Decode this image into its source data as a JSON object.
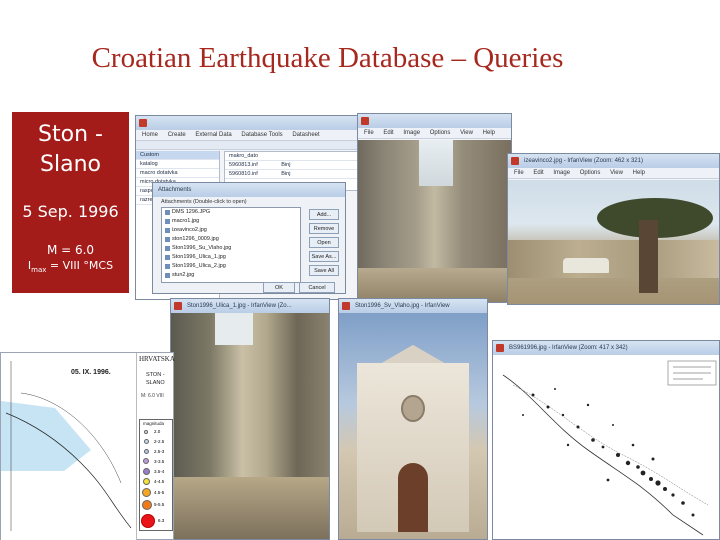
{
  "slide": {
    "title": "Croatian Earthquake Database – Queries"
  },
  "info": {
    "place": "Ston - Slano",
    "date": "5 Sep. 1996",
    "magnitude": "M = 6.0",
    "intensity_prefix": "I",
    "intensity_sub": "max",
    "intensity_rest": " =  VIII °MCS"
  },
  "access_window": {
    "menu": [
      "Home",
      "Create",
      "External Data",
      "Database Tools",
      "Datasheet"
    ],
    "nav_items": [
      "Custom",
      "katalog",
      "macro dotatvka",
      "micro dotatvka",
      "rasporedi",
      "razresj"
    ],
    "table_values": [
      "makro_dato",
      "5960813.inf",
      "5960810.inf"
    ],
    "table_right": [
      "Binj",
      "Binj"
    ]
  },
  "attachments_dialog": {
    "title": "Attachments",
    "label": "Attachments (Double-click to open)",
    "files": [
      "DMS 1296.JPG",
      "macro1.jpg",
      "izeavinco2.jpg",
      "ston1296_0009.jpg",
      "Ston1996_Su_Vlaho.jpg",
      "Ston1996_Ulica_1.jpg",
      "Ston1996_Ulica_2.jpg",
      "stun2.jpg"
    ],
    "buttons": [
      "Add...",
      "Remove",
      "Open",
      "Save As...",
      "Save All"
    ],
    "ok": "OK",
    "cancel": "Cancel"
  },
  "viewer_windows": {
    "street1_menu": [
      "File",
      "Edit",
      "Image",
      "Options",
      "View",
      "Help"
    ],
    "tree_title": "izeavinco2.jpg - IrfanView (Zoom: 462 x 321)",
    "tree_menu": [
      "File",
      "Edit",
      "Image",
      "Options",
      "View",
      "Help"
    ],
    "street2_title": "Ston1996_Ulica_1.jpg - IrfanView (Zo...",
    "church_title": "Ston1996_Sv_Vlaho.jpg - IrfanView",
    "map_title": "BS961996.jpg - IrfanView (Zoom: 417 x 342)"
  },
  "map_doc": {
    "date_label": "05. IX. 1996.",
    "header": "HRVATSKA",
    "place": "STON - SLANO",
    "note": "M: 6.0 VIII",
    "legend_title": "magnituda",
    "legend_items": [
      "2.0",
      "2-2.5",
      "2.5-3",
      "3-3.5",
      "3.5-4",
      "4-4.5",
      "4.5-5",
      "5-5.5",
      "6.3"
    ]
  },
  "colors": {
    "title": "#a6281e",
    "info_box": "#a41c1a"
  }
}
